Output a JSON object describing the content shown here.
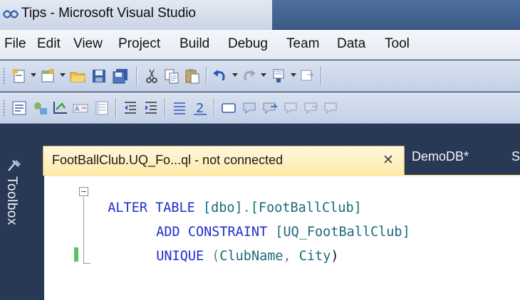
{
  "window": {
    "title": "Tips - Microsoft Visual Studio"
  },
  "menu": [
    "File",
    "Edit",
    "View",
    "Project",
    "Build",
    "Debug",
    "Team",
    "Data",
    "Tool"
  ],
  "toolbox": {
    "label": "Toolbox"
  },
  "tabs": {
    "active": "FootBallClub.UQ_Fo...ql - not connected",
    "close_glyph": "✕",
    "inactive": "DemoDB*",
    "overflow": "S"
  },
  "editor": {
    "line1": {
      "kw1": "ALTER TABLE",
      "schema": "[dbo]",
      "dot": ".",
      "table": "[FootBallClub]"
    },
    "line2": {
      "kw1": "ADD CONSTRAINT",
      "name": "[UQ_FootBallClub]"
    },
    "line3": {
      "kw1": "UNIQUE",
      "open": "(",
      "col1": "ClubName",
      "comma": ",",
      "col2": "City",
      "close": ")"
    }
  },
  "colors": {
    "keyword": "#1c2fd1",
    "identifier": "#1a6a7a",
    "chrome": "#293955",
    "active_tab": "#ffe9a6"
  }
}
